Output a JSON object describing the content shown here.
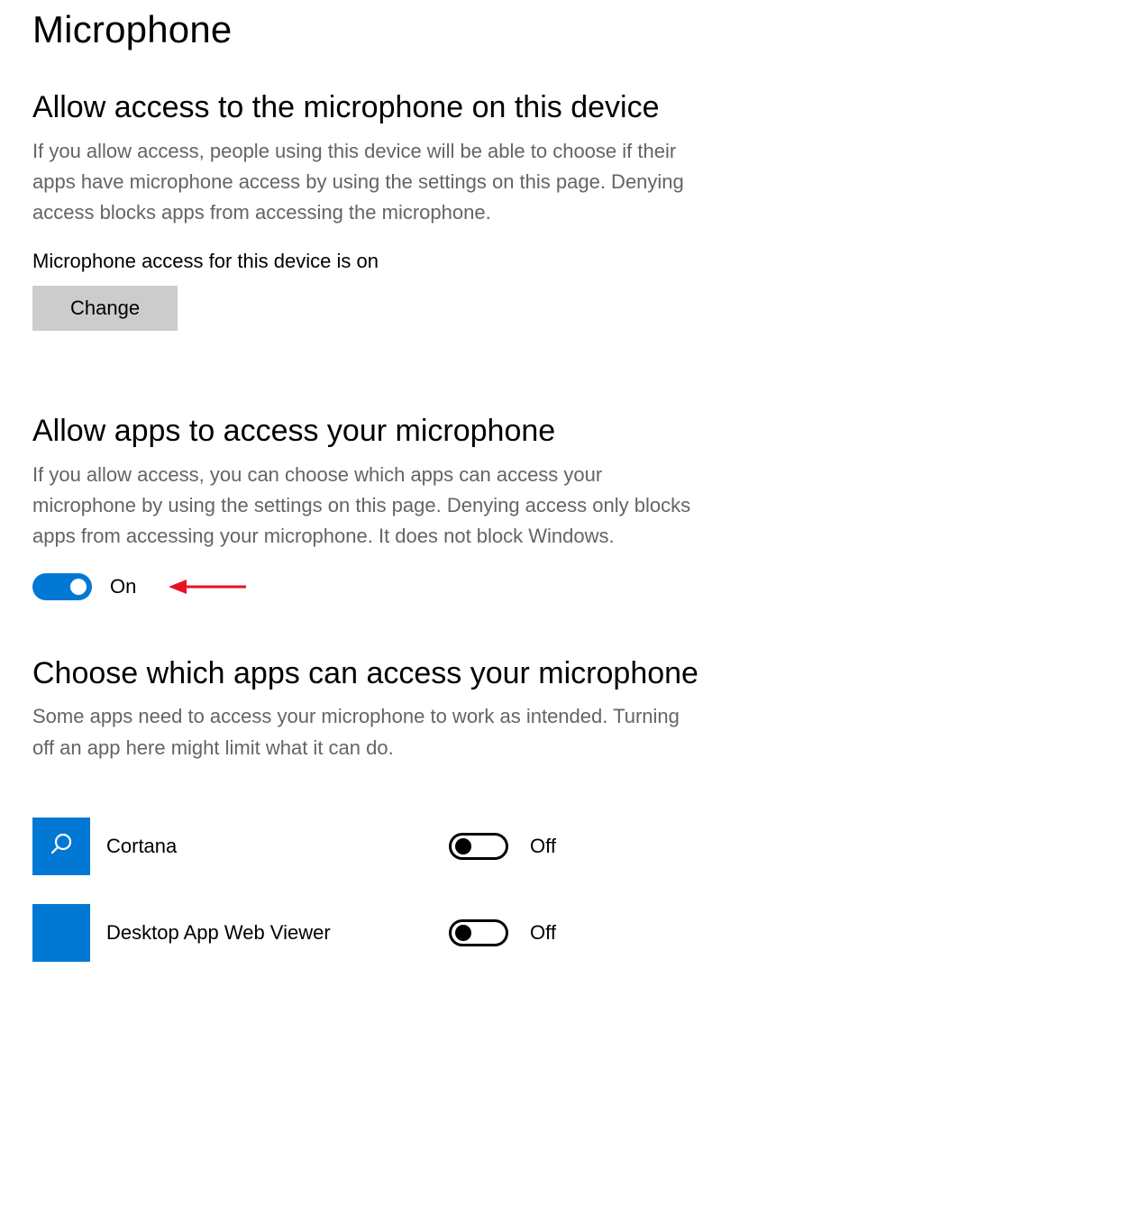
{
  "page_title": "Microphone",
  "section1": {
    "heading": "Allow access to the microphone on this device",
    "description": "If you allow access, people using this device will be able to choose if their apps have microphone access by using the settings on this page. Denying access blocks apps from accessing the microphone.",
    "status": "Microphone access for this device is on",
    "change_button": "Change"
  },
  "section2": {
    "heading": "Allow apps to access your microphone",
    "description": "If you allow access, you can choose which apps can access your microphone by using the settings on this page. Denying access only blocks apps from accessing your microphone. It does not block Windows.",
    "toggle_state": true,
    "toggle_label": "On"
  },
  "section3": {
    "heading": "Choose which apps can access your microphone",
    "description": "Some apps need to access your microphone to work as intended. Turning off an app here might limit what it can do.",
    "apps": [
      {
        "name": "Cortana",
        "state": false,
        "label": "Off",
        "icon": "search-icon"
      },
      {
        "name": "Desktop App Web Viewer",
        "state": false,
        "label": "Off",
        "icon": "blank-icon"
      }
    ]
  },
  "annotation": {
    "arrow_color": "#e81123"
  }
}
